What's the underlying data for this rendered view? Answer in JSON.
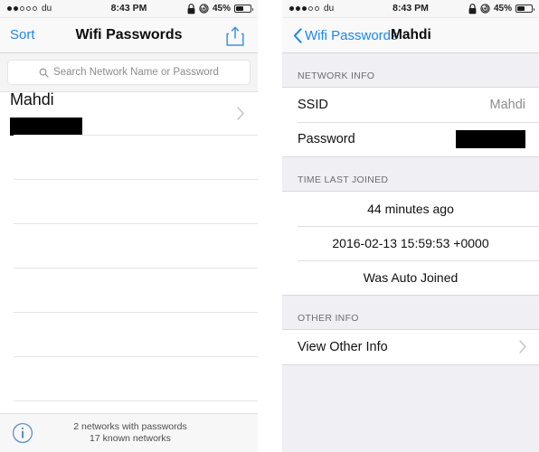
{
  "left_panel": {
    "status_bar": {
      "signal_dots_filled": 2,
      "signal_dots_total": 5,
      "carrier": "du",
      "time": "8:43 PM",
      "battery_percent": "45%",
      "battery_level": 45,
      "lock_icon": "lock-icon",
      "rotation_lock_icon": "rotation-lock-icon"
    },
    "nav": {
      "left_button": "Sort",
      "title": "Wifi Passwords",
      "share_icon": "share-icon"
    },
    "search": {
      "placeholder": "Search Network Name or Password",
      "value": "",
      "icon": "search-icon"
    },
    "networks": [
      {
        "ssid": "Mahdi",
        "password_redacted": true
      }
    ],
    "empty_row_count": 7,
    "footer": {
      "icon": "info-circle-icon",
      "line1": "2 networks with passwords",
      "line2": "17 known networks"
    }
  },
  "right_panel": {
    "status_bar": {
      "signal_dots_filled": 3,
      "signal_dots_total": 5,
      "carrier": "du",
      "time": "8:43 PM",
      "battery_percent": "45%",
      "battery_level": 45,
      "lock_icon": "lock-icon",
      "rotation_lock_icon": "rotation-lock-icon"
    },
    "nav": {
      "back_icon": "chevron-left-icon",
      "back_label": "Wifi Passwords",
      "title": "Mahdi"
    },
    "sections": [
      {
        "header": "NETWORK INFO",
        "rows": [
          {
            "label": "SSID",
            "value": "Mahdi",
            "type": "label-value"
          },
          {
            "label": "Password",
            "value": "",
            "type": "label-redacted"
          }
        ]
      },
      {
        "header": "TIME LAST JOINED",
        "rows": [
          {
            "label": "44 minutes ago",
            "type": "centered"
          },
          {
            "label": "2016-02-13 15:59:53 +0000",
            "type": "centered"
          },
          {
            "label": "Was Auto Joined",
            "type": "centered"
          }
        ]
      },
      {
        "header": "OTHER INFO",
        "rows": [
          {
            "label": "View Other Info",
            "type": "disclosure",
            "icon": "chevron-right-icon"
          }
        ]
      }
    ]
  },
  "colors": {
    "accent_blue": "#1b86f0",
    "group_background": "#efeff4",
    "separator": "#d9d9db",
    "secondary_text": "#8e8e93",
    "redaction": "#000000"
  }
}
